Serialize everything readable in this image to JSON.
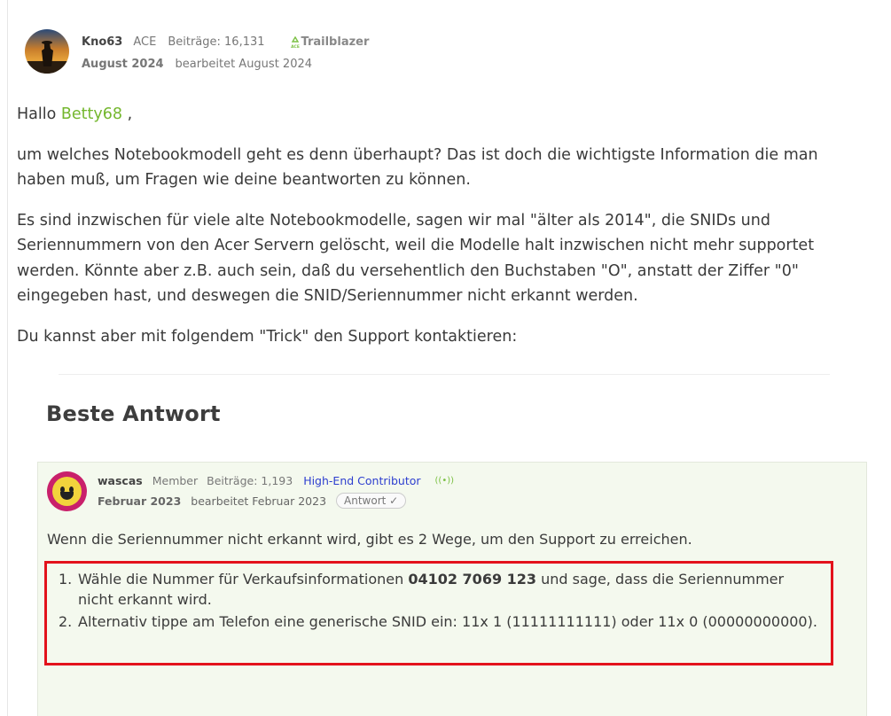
{
  "post": {
    "author": "Kno63",
    "rank": "ACE",
    "posts_label": "Beiträge: 16,131",
    "badge": "Trailblazer",
    "date": "August 2024",
    "edited": "bearbeitet August 2024",
    "greeting_prefix": "Hallo",
    "mention": "Betty68",
    "greeting_suffix": " ,",
    "paragraphs": [
      "um welches Notebookmodell geht es denn überhaupt? Das ist doch die wichtigste Information die man haben muß, um Fragen wie deine beantworten zu können.",
      "Es sind inzwischen für viele alte Notebookmodelle, sagen wir mal \"älter als 2014\", die SNIDs und Seriennummern von den Acer Servern gelöscht, weil die Modelle halt inzwischen nicht mehr supportet werden. Könnte aber z.B. auch sein, daß du versehentlich den Buchstaben \"O\", anstatt der Ziffer \"0\" eingegeben hast, und deswegen die SNID/Seriennummer nicht erkannt werden.",
      "Du kannst aber mit folgendem \"Trick\" den Support kontaktieren:"
    ]
  },
  "embed": {
    "title": "Beste Antwort",
    "author": "wascas",
    "rank": "Member",
    "posts_label": "Beiträge: 1,193",
    "badge": "High-End Contributor",
    "date": "Februar 2023",
    "edited": "bearbeitet Februar 2023",
    "answer_tag": "Antwort ✓",
    "intro": "Wenn die Seriennummer nicht erkannt wird, gibt es 2 Wege, um den Support zu erreichen.",
    "list": [
      {
        "num": "1.",
        "pre": "Wähle die Nummer für Verkaufsinformationen ",
        "bold": "04102 7069 123",
        "post": " und sage, dass die Seriennummer nicht erkannt wird."
      },
      {
        "num": "2.",
        "pre": "Alternativ tippe am Telefon eine generische SNID ein: 11x 1 (11111111111) oder 11x 0 (00000000000).",
        "bold": "",
        "post": ""
      }
    ]
  },
  "colors": {
    "mention": "#74b72e",
    "embed_background": "#f4f9ee",
    "highlight_border": "#e3121c",
    "contributor_badge": "#2d3ecf"
  }
}
